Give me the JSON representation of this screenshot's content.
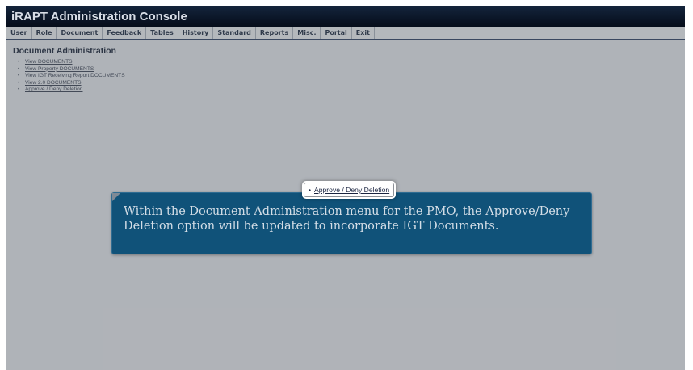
{
  "app": {
    "title": "iRAPT Administration Console"
  },
  "menu": {
    "items": [
      {
        "label": "User"
      },
      {
        "label": "Role"
      },
      {
        "label": "Document"
      },
      {
        "label": "Feedback"
      },
      {
        "label": "Tables"
      },
      {
        "label": "History"
      },
      {
        "label": "Standard"
      },
      {
        "label": "Reports"
      },
      {
        "label": "Misc."
      },
      {
        "label": "Portal"
      },
      {
        "label": "Exit"
      }
    ]
  },
  "main": {
    "section_title": "Document Administration",
    "links": [
      {
        "label": "View DOCUMENTS"
      },
      {
        "label": "View Property DOCUMENTS"
      },
      {
        "label": "View IGT Receiving Report DOCUMENTS"
      },
      {
        "label": "View 2.0 DOCUMENTS"
      },
      {
        "label": "Approve / Deny Deletion"
      }
    ]
  },
  "callout": {
    "highlight_label": "Approve / Deny Deletion",
    "text": "Within the Document Administration menu for the PMO, the Approve/Deny Deletion option will be updated to incorporate IGT Documents."
  }
}
